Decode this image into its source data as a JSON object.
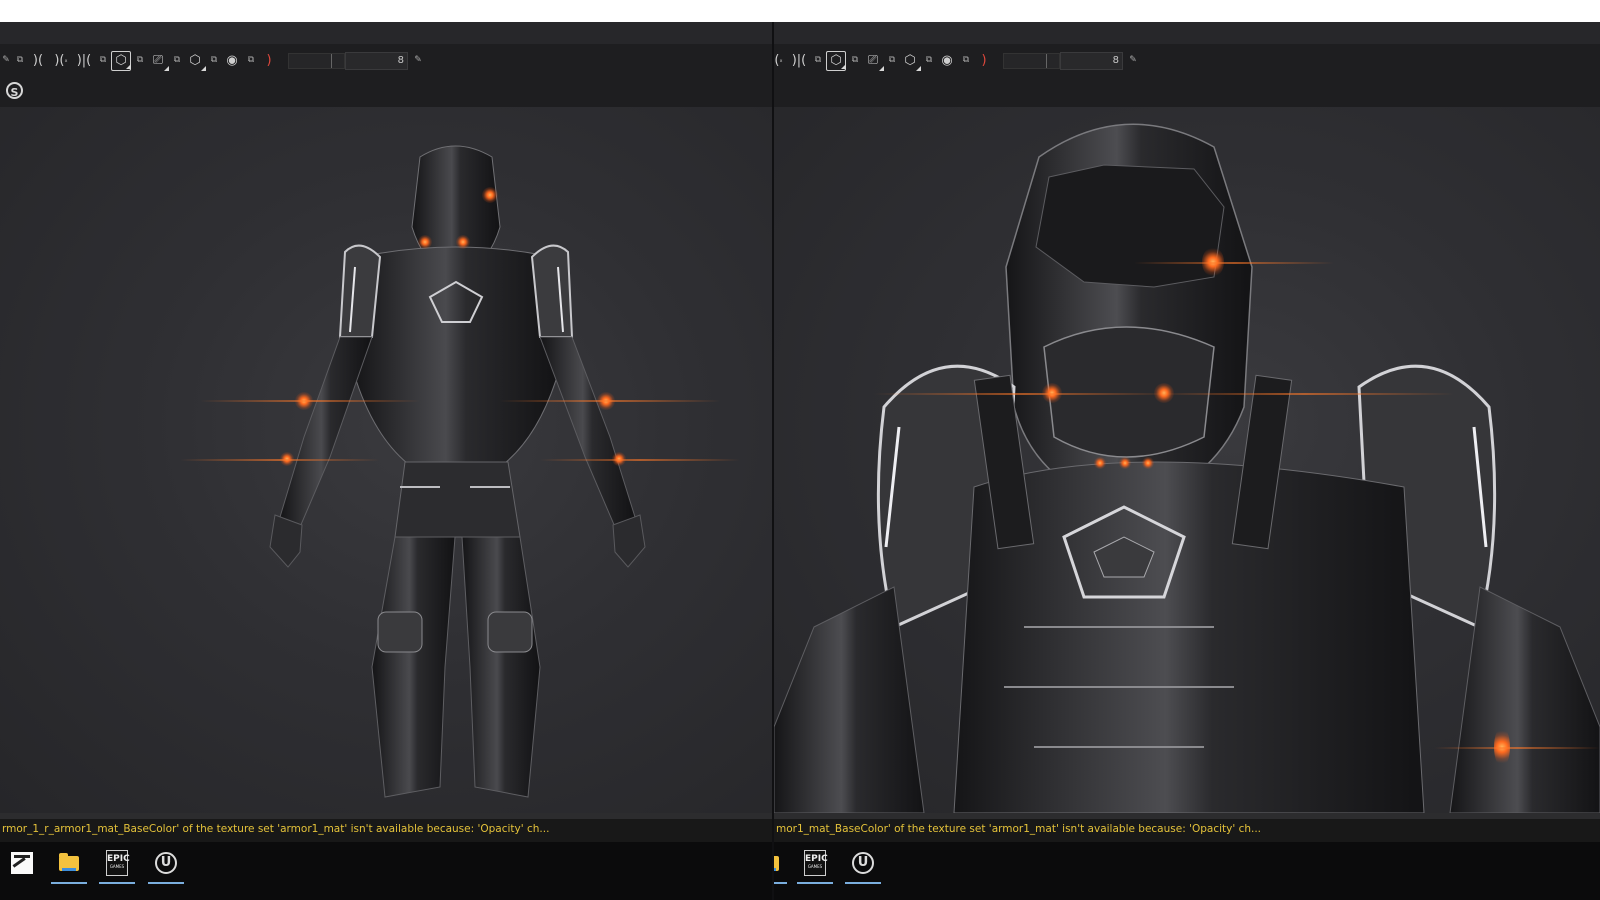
{
  "left_pane": {
    "toolbar": {
      "icons": [
        "pen-icon",
        "popout-icon",
        "brush-icon",
        "smudge-icon",
        "popout-icon",
        "clone-icon",
        "symmetry-icon",
        "popout-icon",
        "render-mode-icon",
        "popout-icon",
        "camera-icon",
        "popout-icon",
        "cube-icon",
        "popout-icon",
        "screenshot-icon",
        "popout-icon",
        "bracket-icon"
      ],
      "field_value": "8"
    },
    "logo": "S",
    "console_message": "rmor_1_r_armor1_mat_BaseColor' of the texture set 'armor1_mat' isn't available because: 'Opacity' ch..."
  },
  "right_pane": {
    "toolbar": {
      "icons": [
        "smudge-icon",
        "symmetry-icon",
        "popout-icon",
        "render-mode-icon",
        "popout-icon",
        "camera-icon",
        "popout-icon",
        "cube-icon",
        "popout-icon",
        "screenshot-icon",
        "popout-icon",
        "bracket-icon"
      ],
      "field_value": "8"
    },
    "console_message": "mor1_mat_BaseColor' of the texture set 'armor1_mat' isn't available because: 'Opacity' ch..."
  },
  "taskbar_left": [
    {
      "name": "zbrush-icon",
      "active": false
    },
    {
      "name": "file-explorer-icon",
      "active": true
    },
    {
      "name": "epic-games-icon",
      "active": true,
      "label": "EPIC",
      "sub": "GAMES"
    },
    {
      "name": "unreal-engine-icon",
      "active": true,
      "label": "U"
    }
  ],
  "taskbar_right": [
    {
      "name": "file-explorer-icon",
      "active": true
    },
    {
      "name": "epic-games-icon",
      "active": true,
      "label": "EPIC",
      "sub": "GAMES"
    },
    {
      "name": "unreal-engine-icon",
      "active": true,
      "label": "U"
    }
  ],
  "colors": {
    "background": "#2f2f33",
    "console_text": "#e4c23a",
    "glow": "#ff6a1f",
    "taskbar": "#0b0b0c"
  }
}
